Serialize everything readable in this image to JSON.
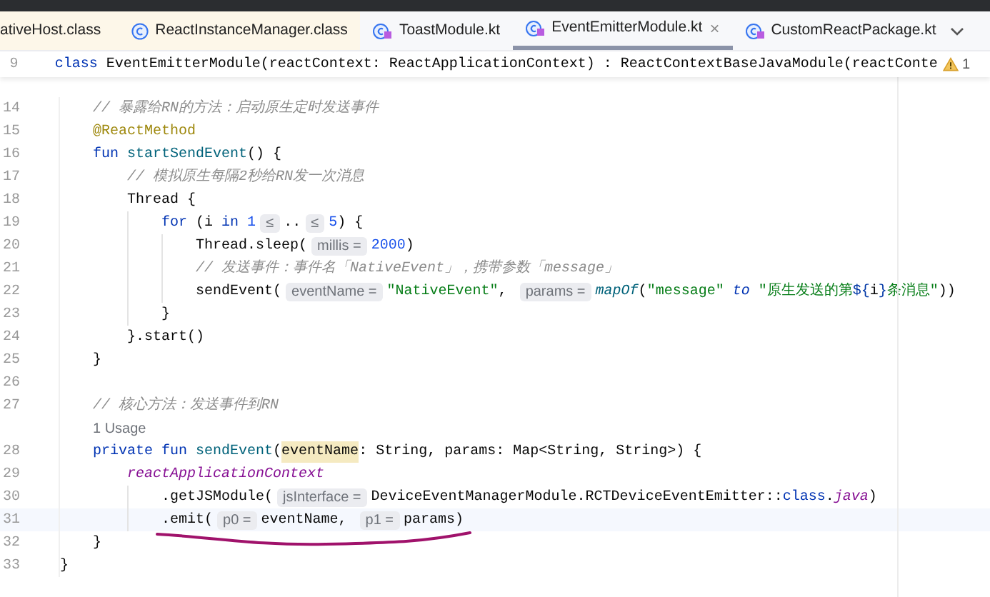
{
  "tabs": [
    {
      "label": "ativeHost.class",
      "kind": "class",
      "selected": false
    },
    {
      "label": "ReactInstanceManager.class",
      "kind": "class",
      "selected": false
    },
    {
      "label": "ToastModule.kt",
      "kind": "kotlin",
      "selected": false
    },
    {
      "label": "EventEmitterModule.kt",
      "kind": "kotlin",
      "selected": true,
      "close": "×"
    },
    {
      "label": "CustomReactPackage.kt",
      "kind": "kotlin",
      "selected": false
    }
  ],
  "sticky_line": {
    "number": "9",
    "tokens": [
      {
        "kind": "keyword",
        "text": "class "
      },
      {
        "kind": "plain",
        "text": "EventEmitterModule(reactContext: ReactApplicationContext) : ReactContextBaseJavaModule(reactConte"
      }
    ],
    "warning_count": "1",
    "children": [
      {
        "number": "14",
        "tokens": [
          {
            "kind": "comment",
            "text": "// 暴露给RN的方法：启动原生定时发送事件"
          }
        ]
      },
      {
        "number": "15",
        "tokens": [
          {
            "kind": "annotation",
            "text": "@ReactMethod"
          }
        ]
      },
      {
        "number": "16",
        "tokens": [
          {
            "kind": "keyword",
            "text": "fun "
          },
          {
            "kind": "function",
            "text": "startSendEvent"
          },
          {
            "kind": "plain",
            "text": "() {"
          }
        ],
        "children": [
          {
            "number": "17",
            "tokens": [
              {
                "kind": "comment",
                "text": "// 模拟原生每隔2秒给RN发一次消息"
              }
            ]
          },
          {
            "number": "18",
            "tokens": [
              {
                "kind": "plain",
                "text": "Thread {"
              }
            ],
            "children": [
              {
                "number": "19",
                "tokens": [
                  {
                    "kind": "keyword",
                    "text": "for"
                  },
                  {
                    "kind": "plain",
                    "text": " (i "
                  },
                  {
                    "kind": "keyword",
                    "text": "in"
                  },
                  {
                    "kind": "number",
                    "text": " 1"
                  },
                  {
                    "kind": "hint",
                    "text": "≤"
                  },
                  {
                    "kind": "plain",
                    "text": ".."
                  },
                  {
                    "kind": "hint",
                    "text": "≤"
                  },
                  {
                    "kind": "number",
                    "text": "5"
                  },
                  {
                    "kind": "plain",
                    "text": ") {"
                  }
                ],
                "children": [
                  {
                    "number": "20",
                    "tokens": [
                      {
                        "kind": "plain",
                        "text": "Thread.sleep("
                      },
                      {
                        "kind": "hint",
                        "text": "millis ="
                      },
                      {
                        "kind": "number",
                        "text": "2000"
                      },
                      {
                        "kind": "plain",
                        "text": ")"
                      }
                    ]
                  },
                  {
                    "number": "21",
                    "tokens": [
                      {
                        "kind": "comment",
                        "text": "// 发送事件：事件名「NativeEvent」，携带参数「message」"
                      }
                    ]
                  },
                  {
                    "number": "22",
                    "tokens": [
                      {
                        "kind": "plain",
                        "text": "sendEvent("
                      },
                      {
                        "kind": "hint",
                        "text": "eventName ="
                      },
                      {
                        "kind": "string",
                        "text": "\"NativeEvent\""
                      },
                      {
                        "kind": "plain",
                        "text": ", "
                      },
                      {
                        "kind": "hint",
                        "text": "params ="
                      },
                      {
                        "kind": "italic-function",
                        "text": "mapOf"
                      },
                      {
                        "kind": "plain",
                        "text": "("
                      },
                      {
                        "kind": "string",
                        "text": "\"message\" "
                      },
                      {
                        "kind": "italic-keyword",
                        "text": "to"
                      },
                      {
                        "kind": "string",
                        "text": " \"原生发送的第"
                      },
                      {
                        "kind": "template",
                        "text": "${"
                      },
                      {
                        "kind": "plain",
                        "text": "i"
                      },
                      {
                        "kind": "template",
                        "text": "}"
                      },
                      {
                        "kind": "string",
                        "text": "条消息\""
                      },
                      {
                        "kind": "plain",
                        "text": "))"
                      }
                    ]
                  }
                ]
              },
              {
                "number": "23",
                "tokens": [
                  {
                    "kind": "plain",
                    "text": "}"
                  }
                ]
              }
            ]
          },
          {
            "number": "24",
            "tokens": [
              {
                "kind": "plain",
                "text": "}.start()"
              }
            ]
          }
        ]
      },
      {
        "number": "25",
        "tokens": [
          {
            "kind": "plain",
            "text": "}"
          }
        ]
      },
      {
        "number": "26"
      },
      {
        "number": "27",
        "tokens": [
          {
            "kind": "comment",
            "text": "// 核心方法：发送事件到RN"
          }
        ]
      },
      {
        "tokens": [
          {
            "kind": "usage",
            "text": "1 Usage"
          }
        ]
      },
      {
        "number": "28",
        "tokens": [
          {
            "kind": "keyword",
            "text": "private fun "
          },
          {
            "kind": "function",
            "text": "sendEvent"
          },
          {
            "kind": "plain",
            "text": "("
          },
          {
            "kind": "highlight",
            "text": "eventName"
          },
          {
            "kind": "plain",
            "text": ": String, params: Map<String, String>) {"
          }
        ],
        "children": [
          {
            "number": "29",
            "tokens": [
              {
                "kind": "property",
                "text": "reactApplicationContext"
              }
            ],
            "children": [
              {
                "number": "30",
                "tokens": [
                  {
                    "kind": "plain",
                    "text": ".getJSModule("
                  },
                  {
                    "kind": "hint",
                    "text": "jsInterface ="
                  },
                  {
                    "kind": "plain",
                    "text": "DeviceEventManagerModule.RCTDeviceEventEmitter::"
                  },
                  {
                    "kind": "keyword",
                    "text": "class"
                  },
                  {
                    "kind": "plain",
                    "text": "."
                  },
                  {
                    "kind": "property",
                    "text": "java"
                  },
                  {
                    "kind": "plain",
                    "text": ")"
                  }
                ]
              },
              {
                "number": "31",
                "current": true,
                "tokens": [
                  {
                    "kind": "plain",
                    "text": ".emit("
                  },
                  {
                    "kind": "hint",
                    "text": "p0 ="
                  },
                  {
                    "kind": "plain",
                    "text": "eventName, "
                  },
                  {
                    "kind": "hint",
                    "text": "p1 ="
                  },
                  {
                    "kind": "plain",
                    "text": "params)"
                  }
                ]
              }
            ]
          }
        ]
      },
      {
        "number": "32",
        "tokens": [
          {
            "kind": "plain",
            "text": "}"
          }
        ]
      }
    ]
  },
  "lines": [
    {
      "number": "33",
      "tokens": [
        {
          "kind": "plain",
          "text": "}"
        }
      ]
    }
  ]
}
